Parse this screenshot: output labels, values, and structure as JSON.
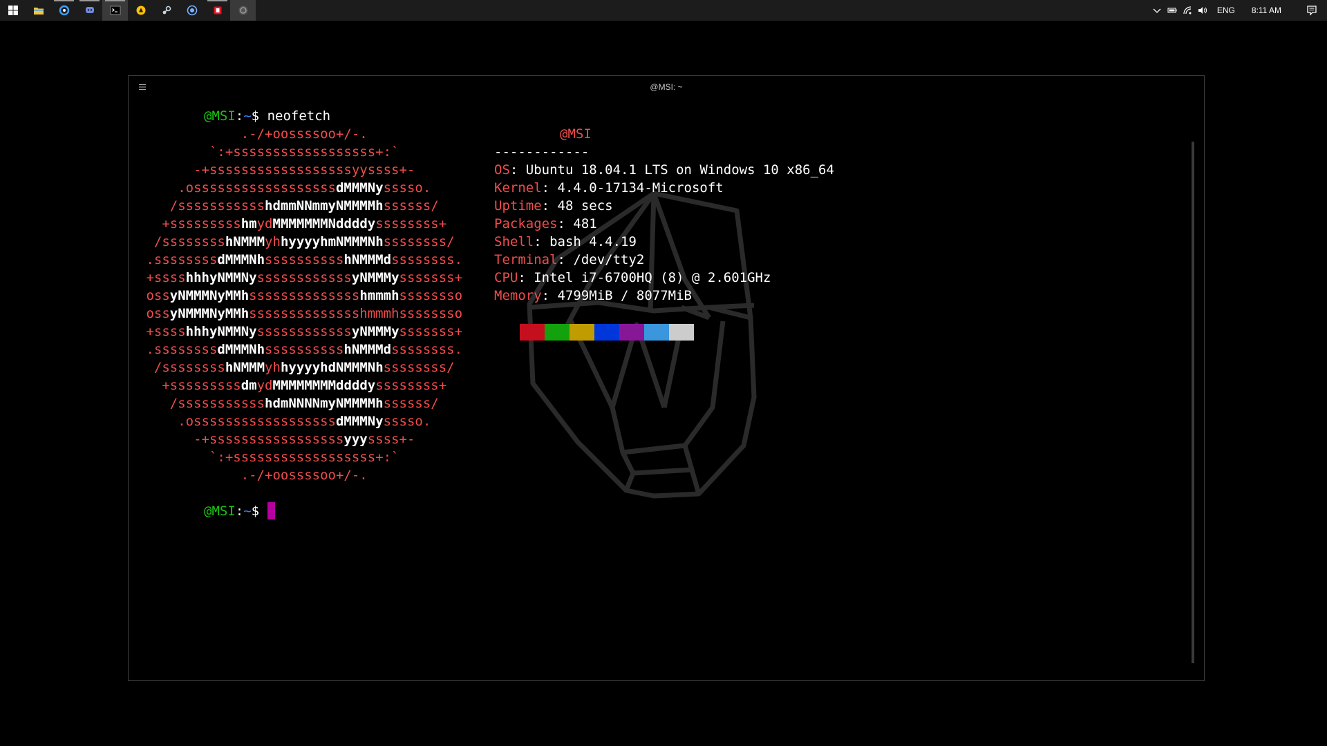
{
  "taskbar": {
    "apps": [
      {
        "name": "start-button",
        "icon": "windows-logo-icon",
        "color": "#ffffff"
      },
      {
        "name": "file-explorer",
        "icon": "folder-icon",
        "color": "#f4c542"
      },
      {
        "name": "app-blue-sync",
        "icon": "sync-icon",
        "color": "#3aa0ff"
      },
      {
        "name": "discord",
        "icon": "discord-icon",
        "color": "#7289da"
      },
      {
        "name": "terminal",
        "icon": "terminal-icon",
        "color": "#ffffff",
        "active": true
      },
      {
        "name": "app-yellow",
        "icon": "yellow-circle-icon",
        "color": "#ffc107"
      },
      {
        "name": "steam",
        "icon": "steam-icon",
        "color": "#c7d5e0"
      },
      {
        "name": "app-blue-badge",
        "icon": "badge-icon",
        "color": "#7ab3ff"
      },
      {
        "name": "app-red",
        "icon": "red-square-icon",
        "color": "#e81123"
      },
      {
        "name": "app-gray",
        "icon": "gray-circle-icon",
        "color": "#888888"
      }
    ],
    "tray": {
      "language": "ENG",
      "time": "8:11 AM"
    }
  },
  "window": {
    "title": "@MSI: ~"
  },
  "terminal": {
    "prompt_user": "@MSI",
    "prompt_sep": ":",
    "prompt_path": "~",
    "prompt_symbol": "$",
    "command": " neofetch",
    "host": "@MSI",
    "dashes": "------------",
    "info": [
      {
        "key": "OS",
        "value": "Ubuntu 18.04.1 LTS on Windows 10 x86_64"
      },
      {
        "key": "Kernel",
        "value": "4.4.0-17134-Microsoft"
      },
      {
        "key": "Uptime",
        "value": "48 secs"
      },
      {
        "key": "Packages",
        "value": "481"
      },
      {
        "key": "Shell",
        "value": "bash 4.4.19"
      },
      {
        "key": "Terminal",
        "value": "/dev/tty2"
      },
      {
        "key": "CPU",
        "value": "Intel i7-6700HQ (8) @ 2.601GHz"
      },
      {
        "key": "Memory",
        "value": "4799MiB / 8077MiB"
      }
    ],
    "palette": [
      "#c50f1f",
      "#13a10e",
      "#c19c00",
      "#0037da",
      "#881798",
      "#3a96dd",
      "#cccccc"
    ],
    "logo": [
      [
        [
          "r",
          "             .-/+oossssoo+/-."
        ]
      ],
      [
        [
          "r",
          "         `:+ssssssssssssssssss+:`"
        ]
      ],
      [
        [
          "r",
          "       -+ssssssssssssssssssyyssss+-"
        ]
      ],
      [
        [
          "r",
          "     .ossssssssssssssssss"
        ],
        [
          "w",
          "dMMMNy"
        ],
        [
          "r",
          "sssso."
        ]
      ],
      [
        [
          "r",
          "    /sssssssssss"
        ],
        [
          "w",
          "hdmmNNmmyNMMMMh"
        ],
        [
          "r",
          "ssssss/"
        ]
      ],
      [
        [
          "r",
          "   +sssssssss"
        ],
        [
          "w",
          "hm"
        ],
        [
          "r",
          "yd"
        ],
        [
          "w",
          "MMMMMMMNddddy"
        ],
        [
          "r",
          "ssssssss+"
        ]
      ],
      [
        [
          "r",
          "  /ssssssss"
        ],
        [
          "w",
          "hNMMM"
        ],
        [
          "r",
          "yh"
        ],
        [
          "w",
          "hyyyyhmNMMMNh"
        ],
        [
          "r",
          "ssssssss/"
        ]
      ],
      [
        [
          "r",
          " .ssssssss"
        ],
        [
          "w",
          "dMMMNh"
        ],
        [
          "r",
          "ssssssssss"
        ],
        [
          "w",
          "hNMMMd"
        ],
        [
          "r",
          "ssssssss."
        ]
      ],
      [
        [
          "r",
          " +ssss"
        ],
        [
          "w",
          "hhhyNMMNy"
        ],
        [
          "r",
          "ssssssssssss"
        ],
        [
          "w",
          "yNMMMy"
        ],
        [
          "r",
          "sssssss+"
        ]
      ],
      [
        [
          "r",
          " oss"
        ],
        [
          "w",
          "yNMMMNyMMh"
        ],
        [
          "r",
          "ssssssssssssss"
        ],
        [
          "w",
          "hmmmh"
        ],
        [
          "r",
          "ssssssso"
        ]
      ],
      [
        [
          "r",
          " oss"
        ],
        [
          "w",
          "yNMMMNyMMh"
        ],
        [
          "r",
          "sssssssssssssshmmmhssssssso"
        ]
      ],
      [
        [
          "r",
          " +ssss"
        ],
        [
          "w",
          "hhhyNMMNy"
        ],
        [
          "r",
          "ssssssssssss"
        ],
        [
          "w",
          "yNMMMy"
        ],
        [
          "r",
          "sssssss+"
        ]
      ],
      [
        [
          "r",
          " .ssssssss"
        ],
        [
          "w",
          "dMMMNh"
        ],
        [
          "r",
          "ssssssssss"
        ],
        [
          "w",
          "hNMMMd"
        ],
        [
          "r",
          "ssssssss."
        ]
      ],
      [
        [
          "r",
          "  /ssssssss"
        ],
        [
          "w",
          "hNMMM"
        ],
        [
          "r",
          "yh"
        ],
        [
          "w",
          "hyyyyhdNMMMNh"
        ],
        [
          "r",
          "ssssssss/"
        ]
      ],
      [
        [
          "r",
          "   +sssssssss"
        ],
        [
          "w",
          "dm"
        ],
        [
          "r",
          "yd"
        ],
        [
          "w",
          "MMMMMMMMddddy"
        ],
        [
          "r",
          "ssssssss+"
        ]
      ],
      [
        [
          "r",
          "    /sssssssssss"
        ],
        [
          "w",
          "hdmNNNNmyNMMMMh"
        ],
        [
          "r",
          "ssssss/"
        ]
      ],
      [
        [
          "r",
          "     .ossssssssssssssssss"
        ],
        [
          "w",
          "dMMMNy"
        ],
        [
          "r",
          "sssso."
        ]
      ],
      [
        [
          "r",
          "       -+sssssssssssssssss"
        ],
        [
          "w",
          "yyy"
        ],
        [
          "r",
          "ssss+-"
        ]
      ],
      [
        [
          "r",
          "         `:+ssssssssssssssssss+:`"
        ]
      ],
      [
        [
          "r",
          "             .-/+oossssoo+/-."
        ]
      ]
    ]
  }
}
